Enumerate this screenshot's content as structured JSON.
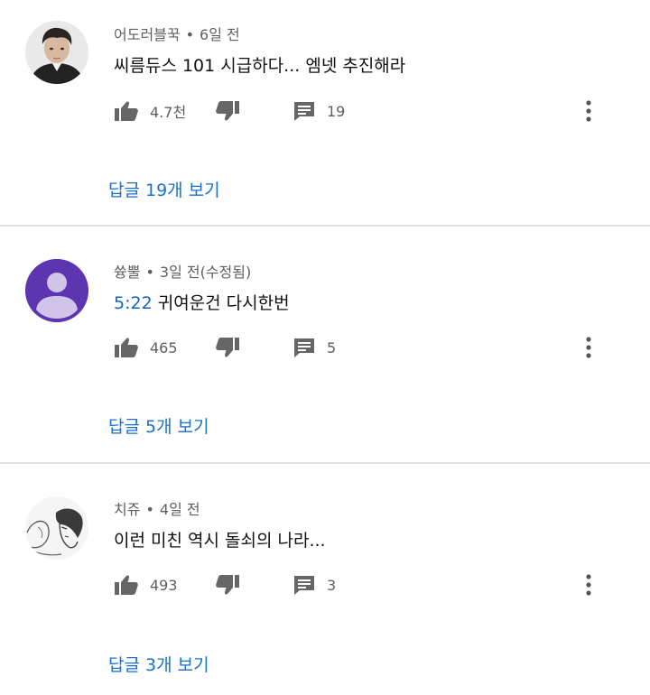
{
  "comments": [
    {
      "author": "어도러블꾹",
      "separator": "•",
      "time": "6일 전",
      "timestamp_link": "",
      "text": "씨름듀스 101 시급하다... 엠넷 추진해라",
      "likes": "4.7천",
      "reply_count": "19",
      "view_replies": "답글 19개 보기",
      "avatar": "photo-avatar"
    },
    {
      "author": "쓩뿔",
      "separator": "•",
      "time": "3일 전(수정됨)",
      "timestamp_link": "5:22",
      "text": "귀여운건 다시한번",
      "likes": "465",
      "reply_count": "5",
      "view_replies": "답글 5개 보기",
      "avatar": "default-person-avatar"
    },
    {
      "author": "치쥬",
      "separator": "•",
      "time": "4일 전",
      "timestamp_link": "",
      "text": "이런 미친 역시 돌쇠의 나라...",
      "likes": "493",
      "reply_count": "3",
      "view_replies": "답글 3개 보기",
      "avatar": "sketch-drawing-avatar"
    }
  ],
  "icons": {
    "like": "thumbs-up-icon",
    "dislike": "thumbs-down-icon",
    "reply": "comment-icon",
    "more": "more-vertical-icon"
  },
  "colors": {
    "link_blue": "#1a6fcf",
    "meta_gray": "#5f5f5f",
    "icon_gray": "#666666",
    "default_avatar_purple": "#5e35b1",
    "divider": "#dedede"
  }
}
